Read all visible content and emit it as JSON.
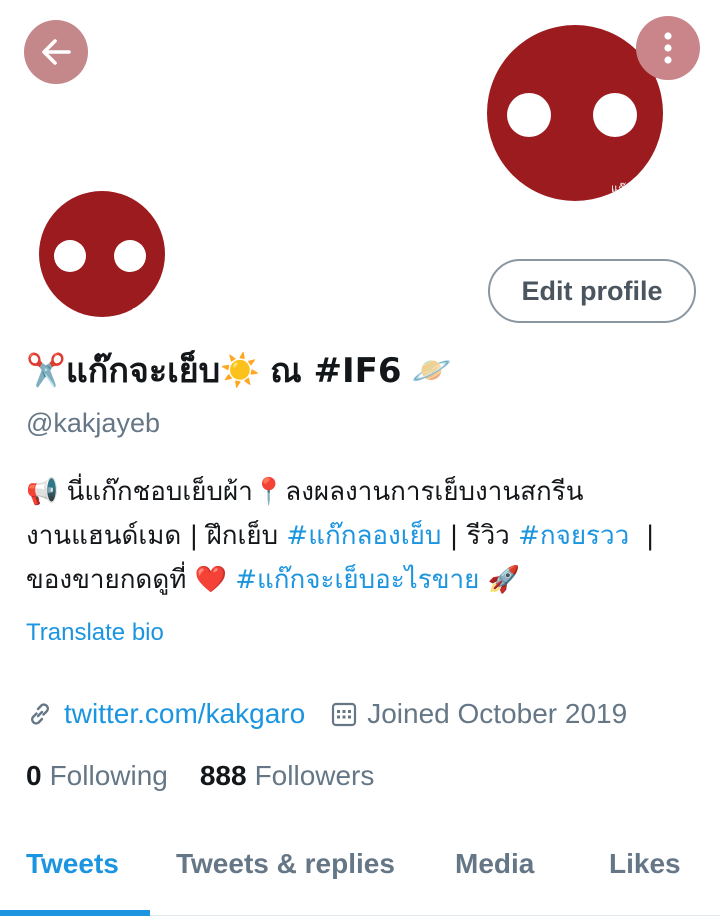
{
  "header": {
    "back_icon": "arrow-left-icon",
    "more_icon": "more-vertical-icon",
    "banner_signature": "แก๊กจะเย็บ"
  },
  "profile": {
    "avatar_signature": "mou",
    "edit_button_label": "Edit profile",
    "name_prefix_emoji": "✂️",
    "name_part1": "แก๊กจะเย็บ",
    "name_sun_emoji": "☀️",
    "name_part2": "ณ #IF6",
    "name_planet_emoji": "🪐",
    "handle": "@kakjayeb"
  },
  "bio": {
    "megaphone_emoji": "📢",
    "line1_text": "นี่แก๊กชอบเย็บผ้า",
    "pin_emoji": "📍",
    "line1_text2": "ลงผลงานการเย็บงานสกรีน",
    "line2_text": "งานแฮนด์เมด | ฝึกเย็บ",
    "line2_tag1": "#แก๊กลองเย็บ",
    "line2_text2": "| รีวิว",
    "line2_tag2": "#กจยรวว",
    "line2_text3": "|",
    "line3_text": "ของขายกดดูที่",
    "heart_emoji": "❤️",
    "line3_tag": "#แก๊กจะเย็บอะไรขาย",
    "rocket_emoji": "🚀"
  },
  "translate_label": "Translate bio",
  "meta": {
    "link_icon": "link-icon",
    "website": "twitter.com/kakgaro",
    "calendar_icon": "calendar-icon",
    "joined": "Joined October 2019"
  },
  "stats": {
    "following_count": "0",
    "following_label": "Following",
    "followers_count": "888",
    "followers_label": "Followers"
  },
  "tabs": [
    {
      "label": "Tweets",
      "active": true
    },
    {
      "label": "Tweets & replies",
      "active": false
    },
    {
      "label": "Media",
      "active": false
    },
    {
      "label": "Likes",
      "active": false
    }
  ],
  "colors": {
    "accent": "#1b95e0",
    "logo_red": "#9b1b1f",
    "muted": "#657786"
  }
}
